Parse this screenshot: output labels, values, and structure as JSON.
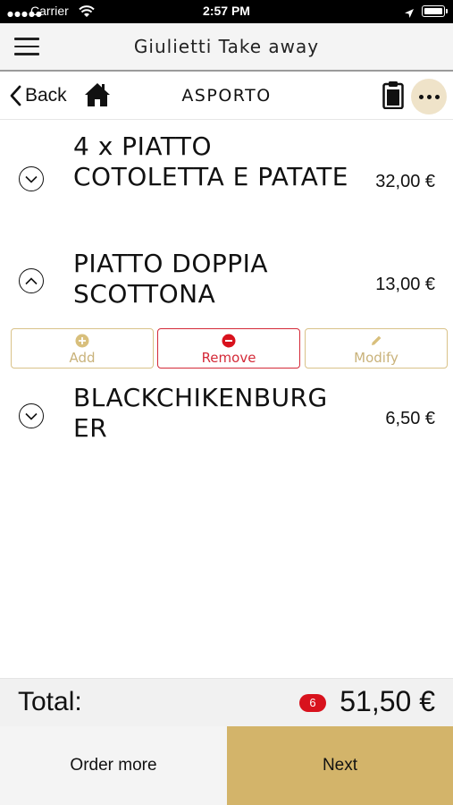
{
  "status_bar": {
    "carrier": "Carrier",
    "time": "2:57 PM"
  },
  "header": {
    "title": "Giulietti Take away"
  },
  "nav": {
    "back_label": "Back",
    "section_title": "ASPORTO"
  },
  "order": {
    "items": [
      {
        "name": "4 x PIATTO COTOLETTA E PATATE",
        "price": "32,00 €",
        "expanded": false
      },
      {
        "name": "PIATTO DOPPIA SCOTTONA",
        "price": "13,00 €",
        "expanded": true
      },
      {
        "name": "BLACKCHIKENBURG ER",
        "price": "6,50 €",
        "expanded": false
      }
    ],
    "actions": {
      "add_label": "Add",
      "remove_label": "Remove",
      "modify_label": "Modify"
    }
  },
  "total": {
    "label": "Total:",
    "count": "6",
    "amount": "51,50 €"
  },
  "footer": {
    "order_more_label": "Order more",
    "next_label": "Next"
  },
  "colors": {
    "accent_gold": "#d3b46a",
    "remove_red": "#d42a38",
    "badge_red": "#d8121d",
    "more_button_bg": "#efe3c9"
  }
}
